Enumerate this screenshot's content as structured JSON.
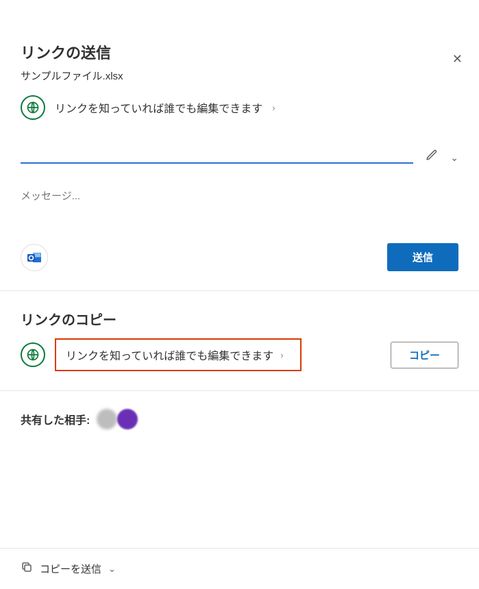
{
  "header": {
    "title": "リンクの送信",
    "filename": "サンプルファイル.xlsx"
  },
  "permission": {
    "text": "リンクを知っていれば誰でも編集できます"
  },
  "inputs": {
    "name_value": "",
    "message_placeholder": "メッセージ..."
  },
  "buttons": {
    "send": "送信",
    "copy": "コピー"
  },
  "copy_section": {
    "title": "リンクのコピー",
    "perm_text": "リンクを知っていれば誰でも編集できます"
  },
  "shared": {
    "label": "共有した相手:"
  },
  "footer": {
    "label": "コピーを送信"
  }
}
